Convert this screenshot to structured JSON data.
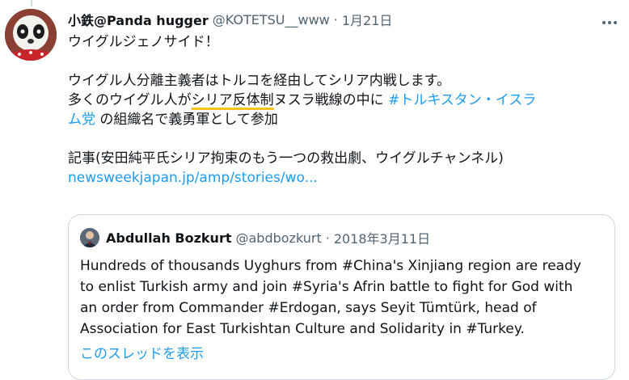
{
  "tweet": {
    "name": "小鉄@Panda hugger",
    "handle": "@KOTETSU__www",
    "separator": "·",
    "date": "1月21日",
    "line1": "ウイグルジェノサイド！",
    "line2": "ウイグル人分離主義者はトルコを経由してシリア内戦します。",
    "line3_a": "多くのウイグル人が",
    "line3_b": "シリア反体制",
    "line3_c": "ヌスラ戦線の中に ",
    "line3_link": "#トルキスタン・イスラ",
    "line4_link": "ム党",
    "line4_rest": " の組織名で義勇軍として参加",
    "line5": "記事(安田純平氏シリア拘束のもう一つの救出劇、ウイグルチャンネル)",
    "url": "newsweekjapan.jp/amp/stories/wo..."
  },
  "quote": {
    "name": "Abdullah Bozkurt",
    "handle": "@abdbozkurt",
    "separator": "·",
    "date": "2018年3月11日",
    "lines": [
      "Hundreds of thousands Uyghurs from #China's Xinjiang region are ready",
      "to enlist Turkish army and join #Syria's Afrin battle to fight for God with",
      "an order from Commander #Erdogan, says Seyit Tümtürk, head of",
      "Association for East Turkishtan Culture and Solidarity in #Turkey."
    ],
    "show_thread": "このスレッドを表示"
  },
  "icons": {
    "more": "more-horizontal-icon",
    "avatar": "panda-avatar",
    "quote_avatar": "profile-photo"
  },
  "colors": {
    "link": "#1d9bf0",
    "secondary": "#536471",
    "highlight": "#f6c21c",
    "border": "#cfd9de"
  }
}
